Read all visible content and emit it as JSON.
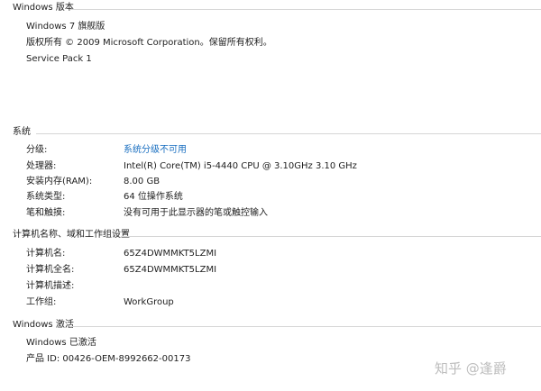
{
  "windows_edition": {
    "title": "Windows 版本",
    "edition": "Windows 7 旗舰版",
    "copyright": "版权所有 © 2009 Microsoft Corporation。保留所有权利。",
    "service_pack": "Service Pack 1"
  },
  "system": {
    "title": "系统",
    "rows": [
      {
        "label": "分级:",
        "value": "系统分级不可用",
        "is_link": true
      },
      {
        "label": "处理器:",
        "value": "Intel(R) Core(TM) i5-4440 CPU @ 3.10GHz   3.10 GHz"
      },
      {
        "label": "安装内存(RAM):",
        "value": "8.00 GB"
      },
      {
        "label": "系统类型:",
        "value": "64 位操作系统"
      },
      {
        "label": "笔和触摸:",
        "value": "没有可用于此显示器的笔或触控输入"
      }
    ]
  },
  "computer_name": {
    "title": "计算机名称、域和工作组设置",
    "rows": [
      {
        "label": "计算机名:",
        "value": "65Z4DWMMKT5LZMI"
      },
      {
        "label": "计算机全名:",
        "value": "65Z4DWMMKT5LZMI"
      },
      {
        "label": "计算机描述:",
        "value": ""
      },
      {
        "label": "工作组:",
        "value": "WorkGroup"
      }
    ]
  },
  "activation": {
    "title": "Windows 激活",
    "status": "Windows 已激活",
    "product_id": "产品 ID: 00426-OEM-8992662-00173"
  },
  "watermark": "知乎 @逢爵",
  "colors": {
    "link": "#1a6fc0",
    "rule": "#d6d6d6",
    "text": "#1e1e1e"
  }
}
